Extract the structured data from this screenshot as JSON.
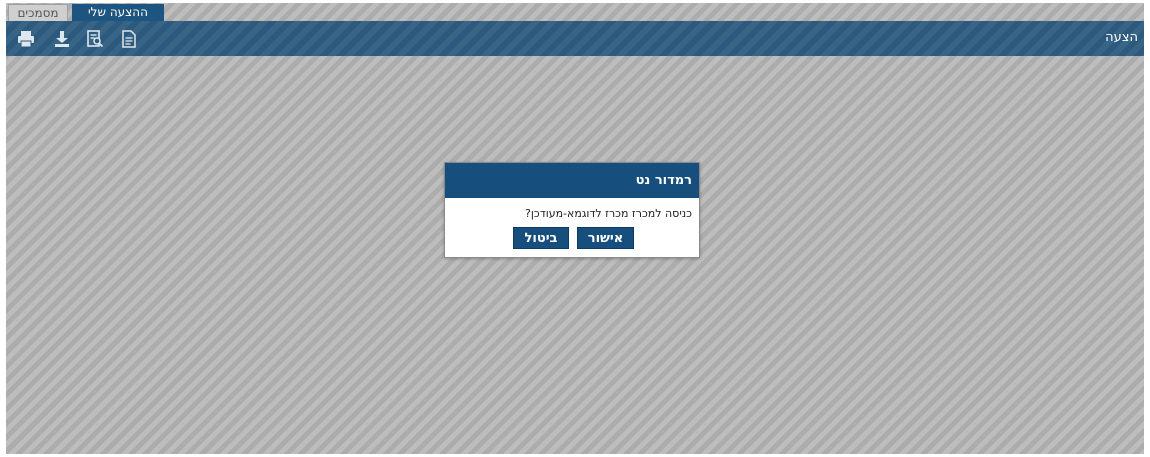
{
  "tabs": {
    "documents": "מסמכים",
    "my_offer": "ההצעה שלי"
  },
  "toolbar": {
    "title": "הצעה",
    "icons": [
      "print-icon",
      "download-icon",
      "preview-icon",
      "document-icon"
    ]
  },
  "dialog": {
    "title": "רמדור נט",
    "message": "כניסה למכרז מכרז לדוגמא-מעודכן?",
    "ok_label": "אישור",
    "cancel_label": "ביטול"
  },
  "colors": {
    "toolbar_bg": "#2c5a7f",
    "dialog_header_bg": "#164f7e",
    "button_bg": "#164f7e",
    "backdrop": "#b2b2b2"
  }
}
